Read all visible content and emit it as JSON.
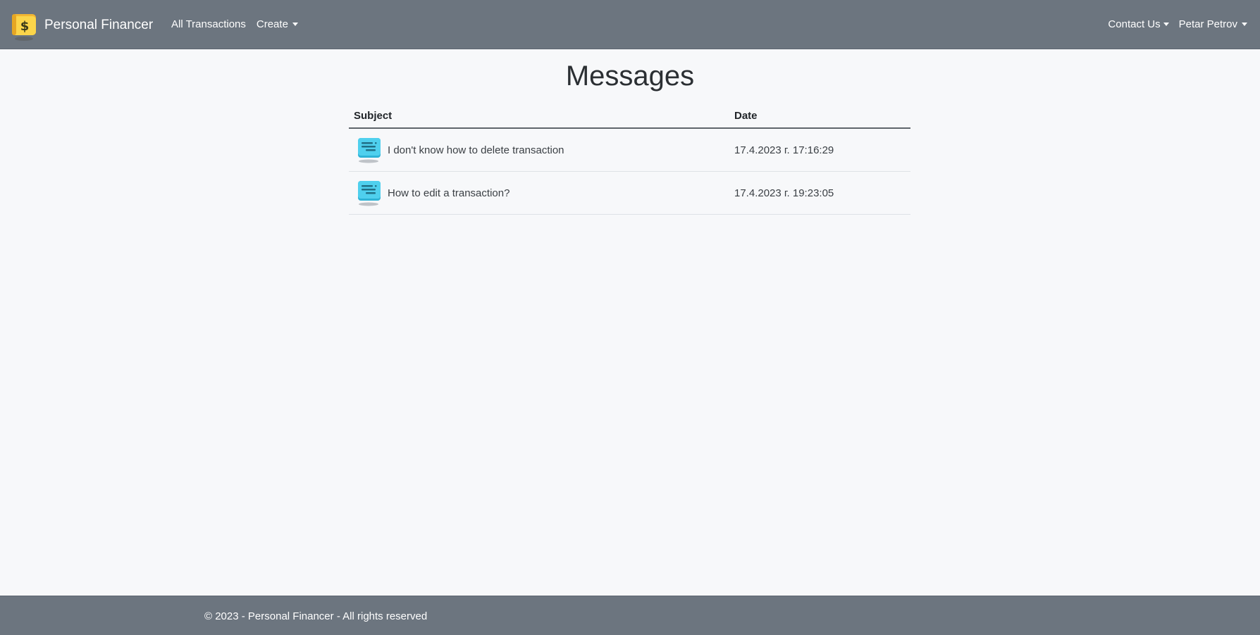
{
  "navbar": {
    "brand": "Personal Financer",
    "left_links": [
      {
        "label": "All Transactions"
      },
      {
        "label": "Create"
      }
    ],
    "right_links": [
      {
        "label": "Contact Us"
      },
      {
        "label": "Petar Petrov"
      }
    ]
  },
  "page": {
    "title": "Messages"
  },
  "table": {
    "columns": [
      "Subject",
      "Date"
    ],
    "rows": [
      {
        "subject": "I don't know how to delete transaction",
        "date": "17.4.2023 г. 17:16:29"
      },
      {
        "subject": "How to edit a transaction?",
        "date": "17.4.2023 г. 19:23:05"
      }
    ]
  },
  "footer": {
    "text": "© 2023 - Personal Financer - All rights reserved"
  },
  "icons": {
    "brand": "wallet-dollar-icon",
    "message": "message-bubble-icon"
  },
  "colors": {
    "navbar": "#6c757f",
    "background": "#f7f8fa",
    "logo_yellow": "#f7c948",
    "message_icon": "#3cc3e3"
  }
}
